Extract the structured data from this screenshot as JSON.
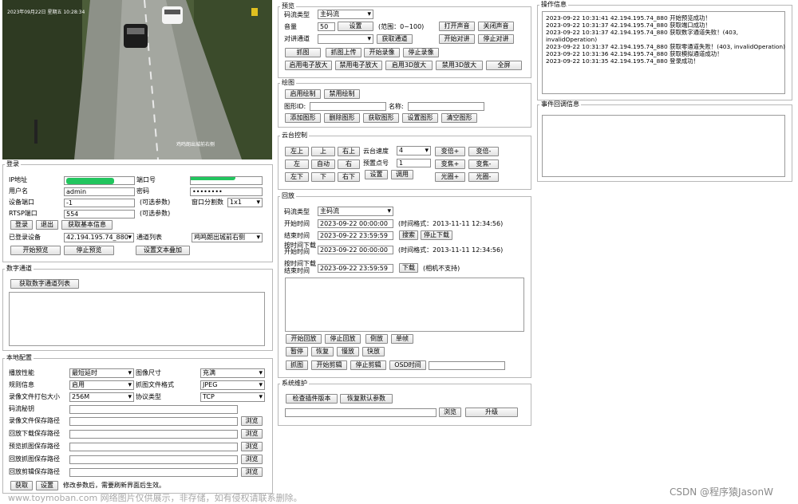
{
  "video": {
    "osd_time": "2023年09月22日 星期五 10:28:34",
    "osd_channel": "鸡鸣朗出城前右侧"
  },
  "login": {
    "legend": "登录",
    "ip_label": "IP地址",
    "port_label": "端口号",
    "user_label": "用户名",
    "user_value": "admin",
    "pwd_label": "密码",
    "pwd_value": "••••••••",
    "devport_label": "设备端口",
    "devport_value": "-1",
    "devport_hint": "(可选参数)",
    "split_label": "窗口分割数",
    "split_value": "1x1",
    "rtsp_label": "RTSP端口",
    "rtsp_value": "554",
    "rtsp_hint": "(可选参数)",
    "btn_login": "登录",
    "btn_logout": "退出",
    "btn_basic": "获取基本信息",
    "logged_label": "已登录设备",
    "logged_value": "42.194.195.74_880",
    "chan_label": "通道列表",
    "chan_value": "鸡鸣朗出城前右侧",
    "btn_start_preview": "开始预览",
    "btn_stop_preview": "停止预览",
    "btn_text_overlay": "设置文本叠加"
  },
  "digital": {
    "legend": "数字通道",
    "btn_get": "获取数字通道列表"
  },
  "local": {
    "legend": "本地配置",
    "perf_label": "播放性能",
    "perf_value": "最短延时",
    "size_label": "图像尺寸",
    "size_value": "充满",
    "rule_label": "规则信息",
    "rule_value": "启用",
    "fmt_label": "抓图文件格式",
    "fmt_value": "JPEG",
    "pack_label": "录像文件打包大小",
    "pack_value": "256M",
    "proto_label": "协议类型",
    "proto_value": "TCP",
    "key_label": "码流秘钥",
    "paths": [
      "录像文件保存路径",
      "回放下载保存路径",
      "预览抓图保存路径",
      "回放抓图保存路径",
      "回放剪辑保存路径"
    ],
    "browse": "浏览",
    "btn_get": "获取",
    "btn_set": "设置",
    "note": "修改参数后，需要刷新界面后生效。"
  },
  "preview": {
    "legend": "预览",
    "stream_label": "码流类型",
    "stream_value": "主码流",
    "vol_label": "音量",
    "vol_value": "50",
    "btn_set": "设置",
    "vol_range": "(范围：0~100)",
    "btn_open_sound": "打开声音",
    "btn_close_sound": "关闭声音",
    "talk_label": "对讲通道",
    "btn_get_talk": "获取通道",
    "btn_start_talk": "开始对讲",
    "btn_stop_talk": "停止对讲",
    "btn_capture": "抓图",
    "btn_capture_upload": "抓图上传",
    "btn_start_rec": "开始录像",
    "btn_stop_rec": "停止录像",
    "btn_ezoom_on": "启用电子放大",
    "btn_ezoom_off": "禁用电子放大",
    "btn_3d_on": "启用3D放大",
    "btn_3d_off": "禁用3D放大",
    "btn_fullscreen": "全屏"
  },
  "draw": {
    "legend": "绘图",
    "btn_enable": "启用绘制",
    "btn_disable": "禁用绘制",
    "id_label": "图形ID:",
    "name_label": "名称:",
    "btn_add": "添加图形",
    "btn_del": "删除图形",
    "btn_get": "获取图形",
    "btn_set": "设置图形",
    "btn_clear": "清空图形"
  },
  "ptz": {
    "legend": "云台控制",
    "up_left": "左上",
    "up": "上",
    "up_right": "右上",
    "left": "左",
    "auto": "自动",
    "right": "右",
    "down_left": "左下",
    "down": "下",
    "down_right": "右下",
    "speed_label": "云台速度",
    "speed_value": "4",
    "preset_label": "预置点号",
    "preset_value": "1",
    "btn_set": "设置",
    "btn_call": "调用",
    "zoom_in": "变倍+",
    "zoom_out": "变倍-",
    "focus_in": "变焦+",
    "focus_out": "变焦-",
    "iris_in": "光圈+",
    "iris_out": "光圈-"
  },
  "playback": {
    "legend": "回放",
    "stream_label": "码流类型",
    "stream_value": "主码流",
    "start_label": "开始时间",
    "start_value": "2023-09-22 00:00:00",
    "fmt_hint": "(时间格式：2013-11-11 12:34:56)",
    "end_label": "结束时间",
    "end_value": "2023-09-22 23:59:59",
    "btn_search": "搜索",
    "btn_stop_dl": "停止下载",
    "dl_start_label1": "按时间下载",
    "dl_start_label2": "开始时间",
    "dl_start_value": "2023-09-22 00:00:00",
    "dl_fmt_hint": "(时间格式：2013-11-11 12:34:56)",
    "dl_end_label1": "按时间下载",
    "dl_end_label2": "结束时间",
    "dl_end_value": "2023-09-22 23:59:59",
    "btn_download": "下载",
    "dl_hint": "(相机不支持)",
    "btn_start_pb": "开始回放",
    "btn_stop_pb": "停止回放",
    "btn_reverse": "倒放",
    "btn_frame": "单帧",
    "btn_pause": "暂停",
    "btn_resume": "恢复",
    "btn_slow": "慢放",
    "btn_fast": "快放",
    "btn_capture": "抓图",
    "btn_start_clip": "开始剪辑",
    "btn_stop_clip": "停止剪辑",
    "btn_osd": "OSD时间"
  },
  "maint": {
    "legend": "系统维护",
    "btn_check": "检查插件版本",
    "btn_restore": "恢复默认参数",
    "btn_browse": "浏览",
    "btn_upgrade": "升级"
  },
  "ops": {
    "legend": "操作信息",
    "lines": [
      "2023-09-22 10:31:41 42.194.195.74_880 开始预览成功！",
      "2023-09-22 10:31:37 42.194.195.74_880 获取端口成功！",
      "2023-09-22 10:31:37 42.194.195.74_880 获取数字通道失败！(403,",
      "invalidOperation)",
      "2023-09-22 10:31:37 42.194.195.74_880 获取零通道失败！(403, invalidOperation)",
      "2023-09-22 10:31:36 42.194.195.74_880 获取模拟通道成功！",
      "2023-09-22 10:31:35 42.194.195.74_880 登录成功！"
    ]
  },
  "events": {
    "legend": "事件回调信息"
  },
  "watermarks": {
    "site": "www.toymoban.com 网络图片仅供展示，非存储，如有侵权请联系删除。",
    "csdn": "CSDN @程序猿JasonW"
  }
}
